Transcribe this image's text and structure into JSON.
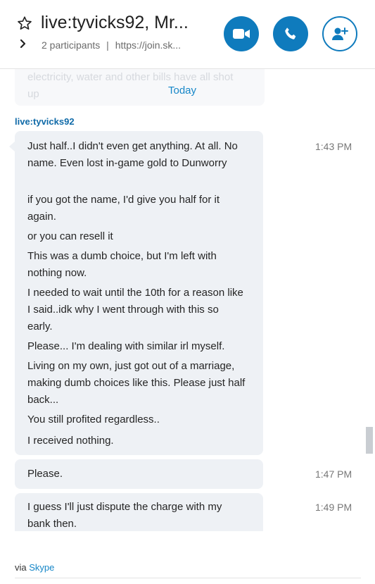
{
  "header": {
    "title": "live:tyvicks92, Mr...",
    "participants": "2 participants",
    "separator": "|",
    "link": "https://join.sk...",
    "icons": {
      "favorite": "star-outline-icon",
      "expand": "chevron-right-icon",
      "video": "video-camera-icon",
      "call": "phone-icon",
      "add_people": "add-person-icon"
    },
    "accent_color": "#0f7bbd"
  },
  "previous_message": {
    "text": "electricity, water and other bills have all shot up"
  },
  "date_divider": "Today",
  "conversation": {
    "sender": "live:tyvicks92",
    "messages": [
      {
        "text": "Just half..I didn't even get anything. At all. No name. Even lost in-game gold to Dunworry"
      },
      {
        "text": "if you got the name, I'd give you half for it again."
      },
      {
        "text": "or you can resell it"
      },
      {
        "text": "This was a dumb choice, but I'm left with nothing now."
      },
      {
        "text": "I needed to wait until the 10th for a reason like I said..idk why I went through with this so early."
      },
      {
        "text": "Please... I'm dealing with similar irl myself."
      },
      {
        "text": "Living on my own, just got out of a marriage, making dumb choices like this. Please just half back..."
      },
      {
        "text": "You still profited regardless.."
      },
      {
        "text": "I received nothing."
      }
    ],
    "group1_time": "1:43 PM",
    "message2": {
      "text": "Please.",
      "time": "1:47 PM"
    },
    "message3": {
      "text": "I guess I'll just dispute the charge with my bank then.",
      "time": "1:49 PM"
    }
  },
  "footer": {
    "via": "via",
    "link": "Skype"
  }
}
